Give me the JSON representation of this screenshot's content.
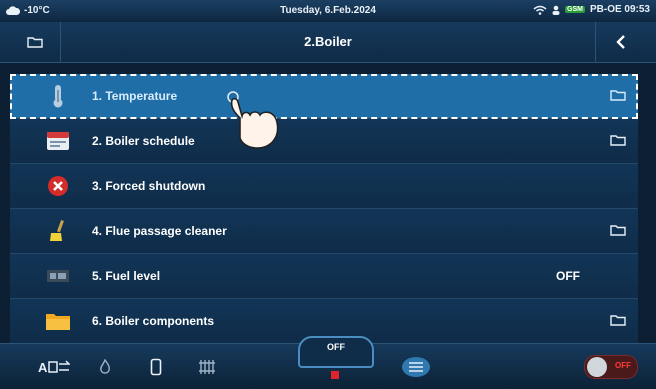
{
  "statusbar": {
    "temperature": "-10°C",
    "date": "Tuesday, 6.Feb.2024",
    "gsm": "GSM",
    "clock": "PB-OE 09:53"
  },
  "header": {
    "title": "2.Boiler"
  },
  "menu": {
    "items": [
      {
        "label": "1. Temperature",
        "icon": "thermometer-icon",
        "value": "",
        "folder": true,
        "selected": true
      },
      {
        "label": "2. Boiler schedule",
        "icon": "calendar-icon",
        "value": "",
        "folder": true,
        "selected": false
      },
      {
        "label": "3. Forced shutdown",
        "icon": "stop-x-icon",
        "value": "",
        "folder": false,
        "selected": false
      },
      {
        "label": "4. Flue passage cleaner",
        "icon": "brush-icon",
        "value": "",
        "folder": true,
        "selected": false
      },
      {
        "label": "5. Fuel level",
        "icon": "fuel-gauge-icon",
        "value": "OFF",
        "folder": false,
        "selected": false
      },
      {
        "label": "6. Boiler components",
        "icon": "folder-icon",
        "value": "",
        "folder": true,
        "selected": false
      }
    ]
  },
  "bottombar": {
    "mode_label": "OFF",
    "toggle_label": "OFF"
  },
  "colors": {
    "accent": "#1f6ea8",
    "background": "#0c1f33",
    "off_red": "#ff3a3a"
  }
}
